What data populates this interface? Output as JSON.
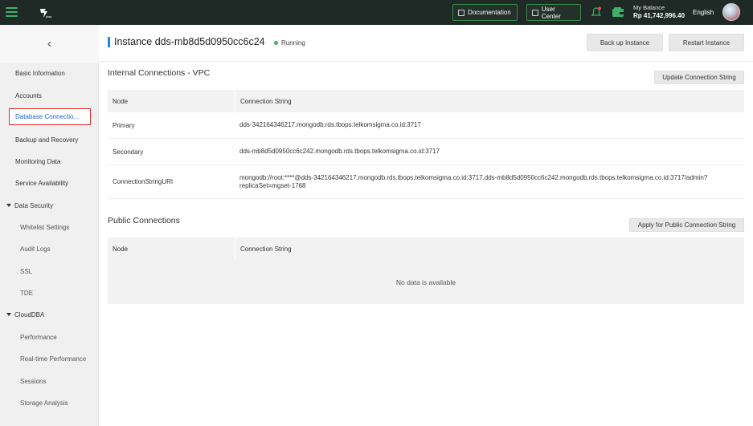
{
  "topbar": {
    "documentation": "Documentation",
    "user_center": "User Center",
    "balance_label": "My Balance",
    "balance_value": "Rp 41,742,996.40",
    "language": "English",
    "accent_color": "#3fb06a"
  },
  "sidebar": {
    "back": "‹",
    "items": [
      {
        "label": "Basic Information"
      },
      {
        "label": "Accounts"
      },
      {
        "label": "Database Connectio..."
      },
      {
        "label": "Backup and Recovery"
      },
      {
        "label": "Monitoring Data"
      },
      {
        "label": "Service Availability"
      },
      {
        "label": "Data Security"
      },
      {
        "label": "Whitelist Settings"
      },
      {
        "label": "Audit Logs"
      },
      {
        "label": "SSL"
      },
      {
        "label": "TDE"
      },
      {
        "label": "CloudDBA"
      },
      {
        "label": "Performance"
      },
      {
        "label": "Real-time Performance"
      },
      {
        "label": "Sessions"
      },
      {
        "label": "Storage Analysis"
      }
    ]
  },
  "header": {
    "title": "Instance dds-mb8d5d0950cc6c24",
    "status": "Running",
    "backup_button": "Back up Instance",
    "restart_button": "Restart Instance"
  },
  "internal": {
    "title": "Internal Connections - VPC",
    "update_button": "Update Connection String",
    "col_node": "Node",
    "col_conn": "Connection String",
    "rows": [
      {
        "node": "Primary",
        "conn": "dds-342164346217.mongodb.rds.tbops.telkomsigma.co.id:3717"
      },
      {
        "node": "Secondary",
        "conn": "dds-mb8d5d0950cc6c242.mongodb.rds.tbops.telkomsigma.co.id:3717"
      },
      {
        "node": "ConnectionStringURI",
        "conn": "mongodb://root:****@dds-342164346217.mongodb.rds.tbops.telkomsigma.co.id:3717,dds-mb8d5d0950cc6c242.mongodb.rds.tbops.telkomsigma.co.id:3717/admin?replicaSet=mgset-1768"
      }
    ]
  },
  "public": {
    "title": "Public Connections",
    "apply_button": "Apply for Public Connection String",
    "col_node": "Node",
    "col_conn": "Connection String",
    "empty": "No data is available"
  }
}
